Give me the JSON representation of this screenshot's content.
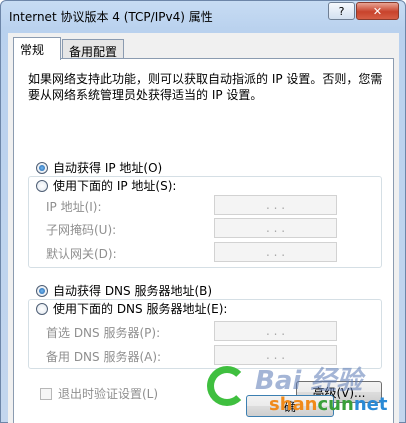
{
  "window": {
    "title": "Internet 协议版本 4 (TCP/IPv4) 属性",
    "help_label": "?",
    "close_label": "✕"
  },
  "tabs": [
    {
      "label": "常规"
    },
    {
      "label": "备用配置"
    }
  ],
  "description": "如果网络支持此功能，则可以获取自动指派的 IP 设置。否则，您需要从网络系统管理员处获得适当的 IP 设置。",
  "ip_section": {
    "auto_label": "自动获得 IP 地址(O)",
    "manual_label": "使用下面的 IP 地址(S):",
    "fields": [
      {
        "label": "IP 地址(I):",
        "value": ".   .   ."
      },
      {
        "label": "子网掩码(U):",
        "value": ".   .   ."
      },
      {
        "label": "默认网关(D):",
        "value": ".   .   ."
      }
    ]
  },
  "dns_section": {
    "auto_label": "自动获得 DNS 服务器地址(B)",
    "manual_label": "使用下面的 DNS 服务器地址(E):",
    "fields": [
      {
        "label": "首选 DNS 服务器(P):",
        "value": ".   .   ."
      },
      {
        "label": "备用 DNS 服务器(A):",
        "value": ".   .   ."
      }
    ]
  },
  "validate_label": "退出时验证设置(L)",
  "buttons": {
    "advanced": "高级(V)...",
    "ok": "确"
  },
  "watermark": {
    "brand": "Bai 经验",
    "sub_a": "shan",
    "sub_b": "cun",
    "sub_c": "net"
  }
}
